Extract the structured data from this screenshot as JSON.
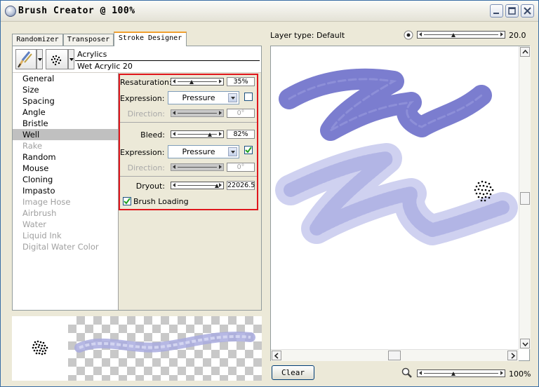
{
  "window": {
    "title": "Brush Creator @ 100%"
  },
  "tabs": [
    {
      "label": "Randomizer",
      "active": false
    },
    {
      "label": "Transposer",
      "active": false
    },
    {
      "label": "Stroke Designer",
      "active": true
    }
  ],
  "brush": {
    "category": "Acrylics",
    "variant": "Wet Acrylic 20"
  },
  "nav": [
    {
      "label": "General",
      "state": "normal"
    },
    {
      "label": "Size",
      "state": "normal"
    },
    {
      "label": "Spacing",
      "state": "normal"
    },
    {
      "label": "Angle",
      "state": "normal"
    },
    {
      "label": "Bristle",
      "state": "normal"
    },
    {
      "label": "Well",
      "state": "selected"
    },
    {
      "label": "Rake",
      "state": "disabled"
    },
    {
      "label": "Random",
      "state": "normal"
    },
    {
      "label": "Mouse",
      "state": "normal"
    },
    {
      "label": "Cloning",
      "state": "normal"
    },
    {
      "label": "Impasto",
      "state": "normal"
    },
    {
      "label": "Image Hose",
      "state": "disabled"
    },
    {
      "label": "Airbrush",
      "state": "disabled"
    },
    {
      "label": "Water",
      "state": "disabled"
    },
    {
      "label": "Liquid Ink",
      "state": "disabled"
    },
    {
      "label": "Digital Water Color",
      "state": "disabled"
    }
  ],
  "well": {
    "resaturation": {
      "label": "Resaturation:",
      "value": "35%",
      "level": 0.35
    },
    "expression1": {
      "label": "Expression:",
      "value": "Pressure",
      "checked": false
    },
    "direction1": {
      "label": "Direction:",
      "value": "0°",
      "level": 0.0
    },
    "bleed": {
      "label": "Bleed:",
      "value": "82%",
      "level": 0.82
    },
    "expression2": {
      "label": "Expression:",
      "value": "Pressure",
      "checked": true
    },
    "direction2": {
      "label": "Direction:",
      "value": "0°",
      "level": 0.0
    },
    "dryout": {
      "label": "Dryout:",
      "value": "22026.5",
      "level": 1.0
    },
    "brush_loading": {
      "label": "Brush Loading",
      "checked": true
    }
  },
  "canvas": {
    "layer_type_label": "Layer type: Default",
    "size_value": "20.0",
    "size_level": 0.4,
    "zoom_value": "100%",
    "zoom_level": 0.4,
    "clear_label": "Clear",
    "stroke_color": "#7b7dcf",
    "stroke_color_light": "#b4b6e6"
  },
  "icons": {
    "app": "app-globe-icon",
    "brush": "brush-category-icon",
    "dab": "dab-type-icon",
    "zoom": "magnifier-icon",
    "size": "brush-size-dot-icon"
  }
}
